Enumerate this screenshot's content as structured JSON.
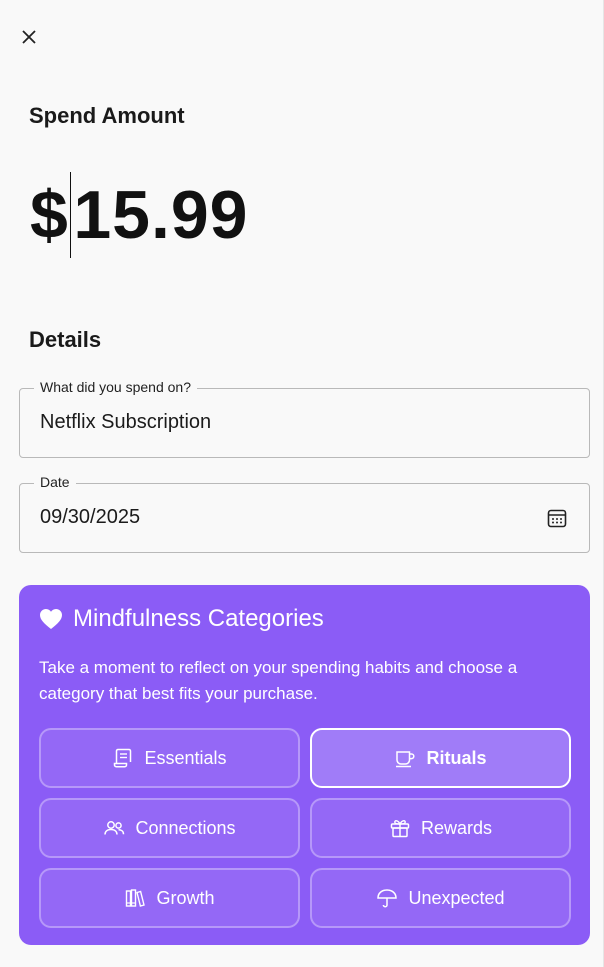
{
  "close": {
    "icon": "close-icon"
  },
  "spend": {
    "title": "Spend Amount",
    "currency": "$",
    "amount": "15.99"
  },
  "details": {
    "title": "Details",
    "item_field": {
      "label": "What did you spend on?",
      "value": "Netflix Subscription"
    },
    "date_field": {
      "label": "Date",
      "value": "09/30/2025",
      "icon": "calendar-icon"
    }
  },
  "mindfulness": {
    "title": "Mindfulness Categories",
    "icon": "heart-icon",
    "description": "Take a moment to reflect on your spending habits and choose a category that best fits your purchase.",
    "accent": "#8b5cf6",
    "categories": [
      {
        "label": "Essentials",
        "icon": "receipt-icon",
        "selected": false
      },
      {
        "label": "Rituals",
        "icon": "coffee-cup-icon",
        "selected": true
      },
      {
        "label": "Connections",
        "icon": "people-icon",
        "selected": false
      },
      {
        "label": "Rewards",
        "icon": "gift-icon",
        "selected": false
      },
      {
        "label": "Growth",
        "icon": "books-icon",
        "selected": false
      },
      {
        "label": "Unexpected",
        "icon": "umbrella-icon",
        "selected": false
      }
    ]
  }
}
